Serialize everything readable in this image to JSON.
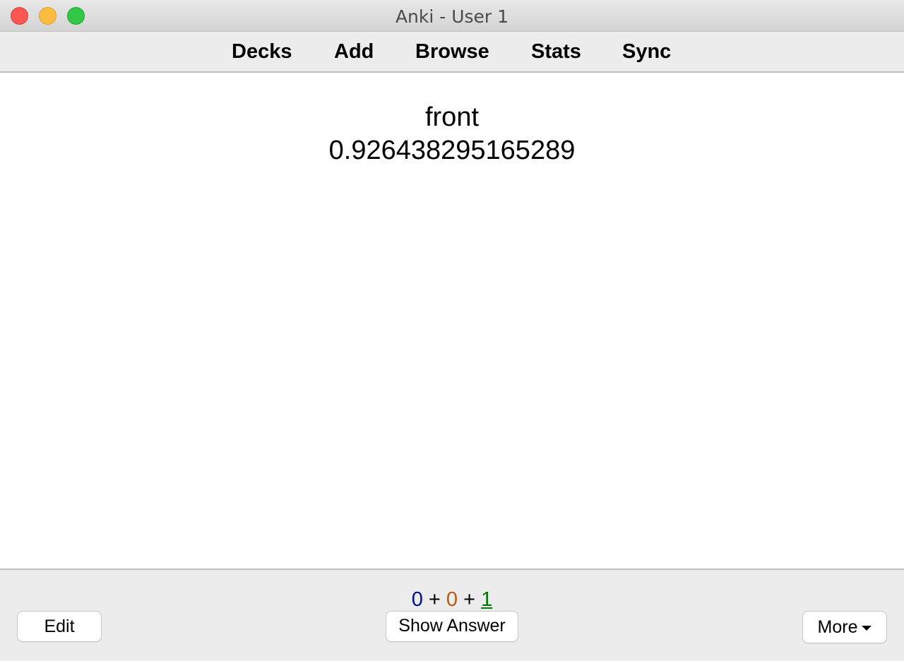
{
  "window": {
    "title": "Anki - User 1"
  },
  "toolbar": {
    "links": [
      {
        "label": "Decks"
      },
      {
        "label": "Add"
      },
      {
        "label": "Browse"
      },
      {
        "label": "Stats"
      },
      {
        "label": "Sync"
      }
    ]
  },
  "card": {
    "front": "front",
    "value": "0.926438295165289"
  },
  "bottom": {
    "counts": {
      "new": "0",
      "learn": "0",
      "review": "1",
      "separator": "+"
    },
    "edit_label": "Edit",
    "show_answer_label": "Show Answer",
    "more_label": "More"
  },
  "colors": {
    "new_count": "#000f9c",
    "learn_count": "#c35617",
    "review_count": "#007700"
  },
  "icons": [
    "close-window-icon",
    "minimize-window-icon",
    "zoom-window-icon",
    "caret-down-icon"
  ]
}
